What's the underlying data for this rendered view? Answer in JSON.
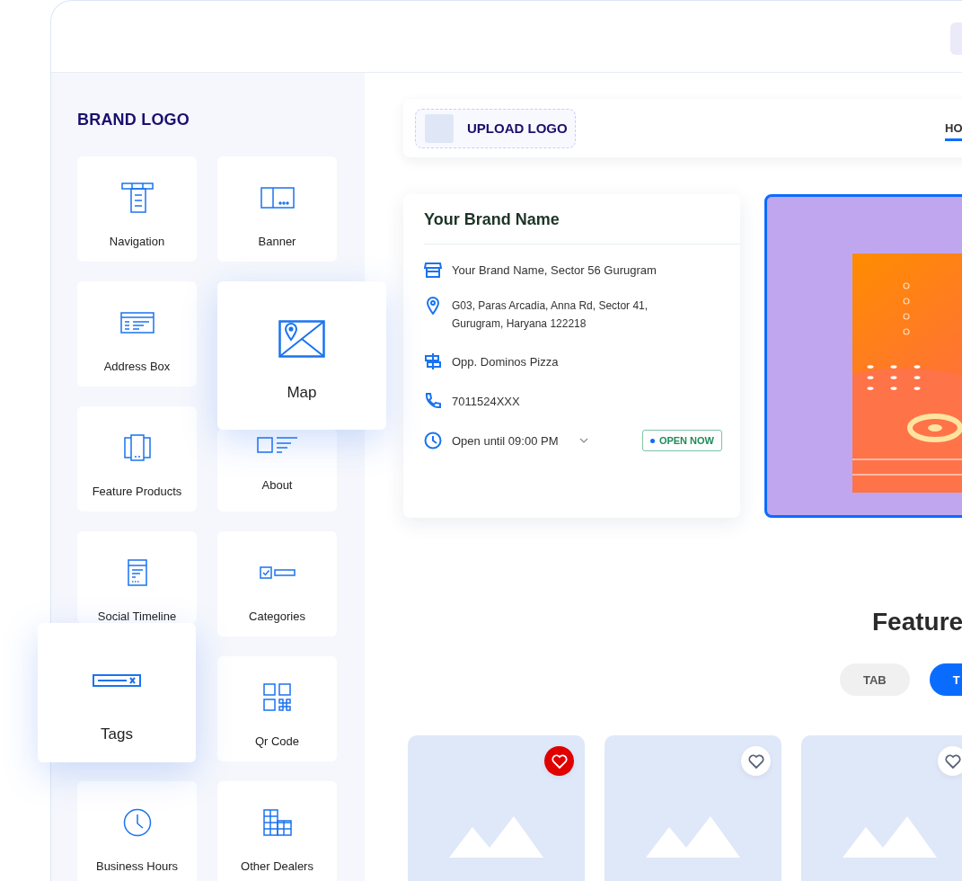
{
  "sidebar": {
    "title": "BRAND LOGO",
    "widgets": [
      {
        "label": "Navigation",
        "lifted": false
      },
      {
        "label": "Banner",
        "lifted": false
      },
      {
        "label": "Address Box",
        "lifted": false
      },
      {
        "label": "Map",
        "lifted": true
      },
      {
        "label": "Feature Products",
        "lifted": false
      },
      {
        "label": "About",
        "lifted": false
      },
      {
        "label": "Social Timeline",
        "lifted": false
      },
      {
        "label": "Categories",
        "lifted": false
      },
      {
        "label": "Tags",
        "lifted": true
      },
      {
        "label": "Qr Code",
        "lifted": false
      },
      {
        "label": "Business Hours",
        "lifted": false
      },
      {
        "label": "Other Dealers",
        "lifted": false
      }
    ]
  },
  "header": {
    "upload_logo": "UPLOAD LOGO",
    "nav": [
      {
        "label": "HO",
        "selected": true
      }
    ]
  },
  "address_card": {
    "title": "Your Brand Name",
    "rows": [
      {
        "kind": "store",
        "text": "Your Brand Name, Sector 56 Gurugram"
      },
      {
        "kind": "pin",
        "text": "G03, Paras Arcadia, Anna Rd, Sector 41, Gurugram, Haryana 122218"
      },
      {
        "kind": "landmark",
        "text": "Opp. Dominos Pizza"
      },
      {
        "kind": "phone",
        "text": "7011524XXX"
      },
      {
        "kind": "hours",
        "text": "Open until 09:00 PM",
        "badge": "OPEN NOW"
      }
    ]
  },
  "section": {
    "title": "Feature",
    "tabs": [
      {
        "label": "TAB",
        "selected": false
      },
      {
        "label": "T",
        "selected": true
      }
    ]
  },
  "products": [
    {
      "favorite": true
    },
    {
      "favorite": false
    },
    {
      "favorite": false
    }
  ]
}
